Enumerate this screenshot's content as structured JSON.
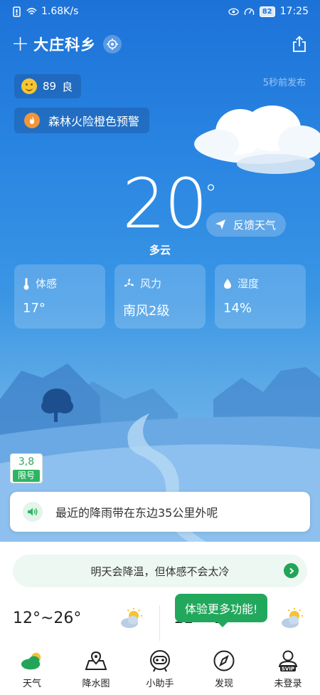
{
  "status_bar": {
    "network_speed": "1.68K/s",
    "battery": "82",
    "time": "17:25"
  },
  "header": {
    "city": "大庄科乡"
  },
  "air_quality": {
    "value": "89",
    "level": "良"
  },
  "publish_time": "5秒前发布",
  "warning": "森林火险橙色预警",
  "weather": {
    "temperature": "20",
    "degree_symbol": "°",
    "condition": "多云"
  },
  "feedback_label": "反馈天气",
  "detail_cards": [
    {
      "title": "体感",
      "value": "17°"
    },
    {
      "title": "风力",
      "value": "南风2级"
    },
    {
      "title": "湿度",
      "value": "14%"
    }
  ],
  "traffic_limit": {
    "numbers": "3,8",
    "label": "限号"
  },
  "rain_notice": "最近的降雨带在东边35公里外呢",
  "tomorrow_notice": "明天会降温，但体感不会太冷",
  "forecast": {
    "today_range": "12°~26°",
    "tomorrow_range": "11°~2"
  },
  "tooltip": "体验更多功能!",
  "tabs": [
    {
      "label": "天气",
      "icon": "weather-icon"
    },
    {
      "label": "降水图",
      "icon": "map-pin-icon"
    },
    {
      "label": "小助手",
      "icon": "assistant-icon"
    },
    {
      "label": "发现",
      "icon": "compass-icon"
    },
    {
      "label": "未登录",
      "icon": "user-svip-icon"
    }
  ],
  "colors": {
    "accent_green": "#22a85c",
    "sky_top": "#1d72d8"
  }
}
